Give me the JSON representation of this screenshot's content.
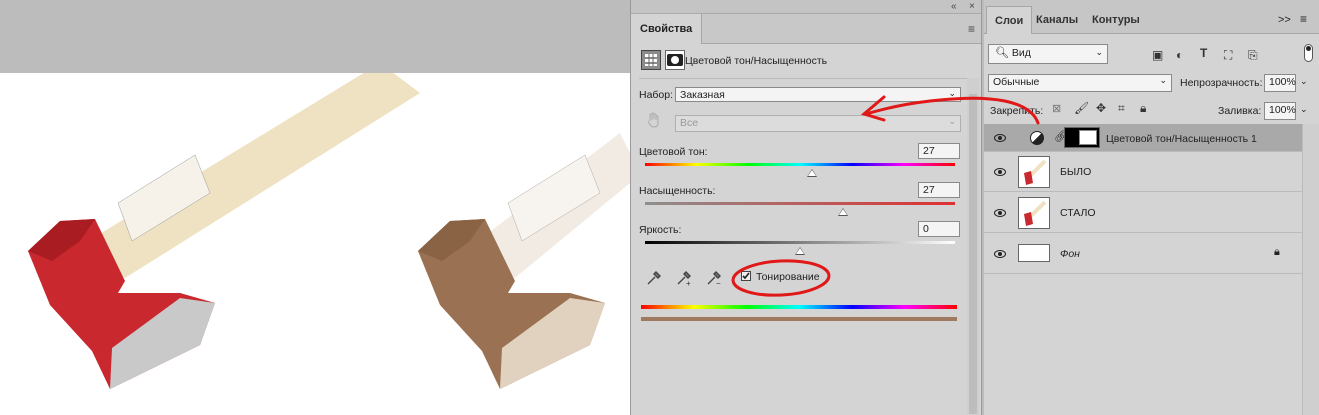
{
  "properties_panel": {
    "collapse_icon": "«",
    "close_icon": "×",
    "tab_title": "Свойства",
    "menu_icon": "≡",
    "adjustment_title": "Цветовой тон/Насыщенность",
    "preset_label": "Набор:",
    "preset_value": "Заказная",
    "channel_value": "Все",
    "hue_label": "Цветовой тон:",
    "hue_value": "27",
    "saturation_label": "Насыщенность:",
    "saturation_value": "27",
    "lightness_label": "Яркость:",
    "lightness_value": "0",
    "colorize_label": "Тонирование",
    "colorize_checked": true,
    "hue_level": 0.54,
    "saturation_level": 0.64,
    "lightness_level": 0.5,
    "result_color": "#a07a5f"
  },
  "layers_panel": {
    "tabs": [
      "Слои",
      "Каналы",
      "Контуры"
    ],
    "expand_icon": ">>",
    "menu_icon": "≡",
    "filter_label": "Вид",
    "blend_mode": "Обычные",
    "opacity_label": "Непрозрачность:",
    "opacity_value": "100%",
    "lock_label": "Закрепить:",
    "fill_label": "Заливка:",
    "fill_value": "100%",
    "layers": [
      {
        "name": "Цветовой тон/Насыщенность 1",
        "type": "adjustment",
        "selected": true
      },
      {
        "name": "БЫЛО",
        "type": "image",
        "selected": false
      },
      {
        "name": "СТАЛО",
        "type": "image",
        "selected": false
      },
      {
        "name": "Фон",
        "type": "background",
        "selected": false,
        "italic": true,
        "locked": true
      }
    ]
  },
  "colors": {
    "annotation_red": "#e01818",
    "axe_red": "#c8282e",
    "axe_brown": "#9a7152",
    "handle": "#efe2c2"
  }
}
